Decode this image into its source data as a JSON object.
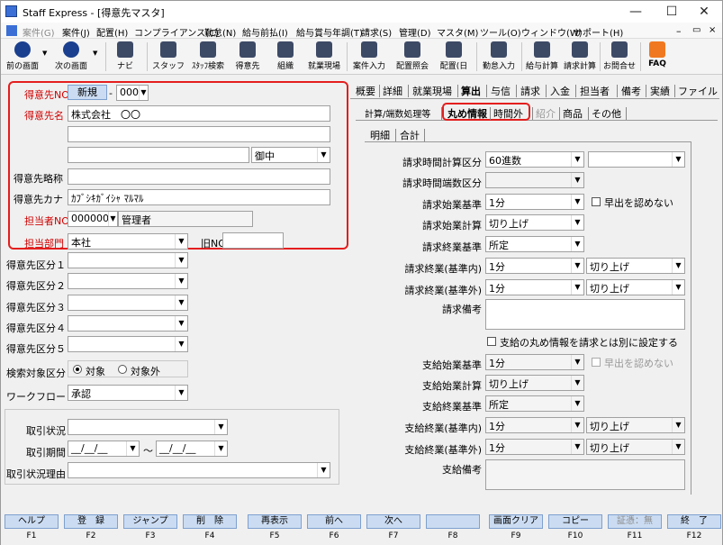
{
  "window": {
    "title": "Staff Express - [得意先マスタ]"
  },
  "menu": [
    {
      "label": "案件(G)",
      "disabled": true
    },
    {
      "label": "案件(J)",
      "disabled": false
    },
    {
      "label": "配置(H)",
      "disabled": false
    },
    {
      "label": "コンプライアンス(C)",
      "disabled": false
    },
    {
      "label": "勤怠(N)",
      "disabled": false
    },
    {
      "label": "給与前払(I)",
      "disabled": false
    },
    {
      "label": "給与賞与年調(T)",
      "disabled": false
    },
    {
      "label": "請求(S)",
      "disabled": false
    },
    {
      "label": "管理(D)",
      "disabled": false
    },
    {
      "label": "マスタ(M)",
      "disabled": false
    },
    {
      "label": "ツール(O)",
      "disabled": false
    },
    {
      "label": "ウィンドウ(W)",
      "disabled": false
    },
    {
      "label": "サポート(H)",
      "disabled": false
    }
  ],
  "toolbar": [
    "前の画面",
    "次の画面",
    "ナビ",
    "スタッフ",
    "ｽﾀｯﾌ検索",
    "得意先",
    "組織",
    "就業現場",
    "案件入力",
    "配置照会",
    "配置(日",
    "勤怠入力",
    "給与計算",
    "請求計算",
    "お問合せ",
    "FAQ"
  ],
  "form": {
    "tokuisaki_no_label": "得意先NO",
    "new_badge": "新規",
    "dash": "-",
    "branch_no": "000",
    "name_label": "得意先名",
    "name": "株式会社　〇〇",
    "name2": "",
    "name3": "",
    "name4": "",
    "honorific": "御中",
    "short_name_label": "得意先略称",
    "short_name": "",
    "kana_label": "得意先カナ",
    "kana": "ｶﾌﾞｼｷｶﾞｲｼｬ ﾏﾙﾏﾙ",
    "tanto_label": "担当者NO",
    "tanto_no": "000000",
    "tanto_name": "管理者",
    "dept_label": "担当部門",
    "dept": "本社",
    "old_no_label": "旧NO",
    "old_no": "",
    "cat1": "得意先区分１",
    "cat2": "得意先区分２",
    "cat3": "得意先区分３",
    "cat4": "得意先区分４",
    "cat5": "得意先区分５",
    "search_label": "検索対象区分",
    "search_opt1": "対象",
    "search_opt2": "対象外",
    "workflow_label": "ワークフロー",
    "workflow": "承認",
    "torihiki_status": "取引状況",
    "torihiki_period": "取引期間",
    "period_from": "__/__/__",
    "tilde": "〜",
    "period_to": "__/__/__",
    "torihiki_reason": "取引状況理由"
  },
  "tabs_main": [
    "概要",
    "詳細",
    "就業現場",
    "算出",
    "与信",
    "請求",
    "入金",
    "担当者",
    "備考",
    "実績",
    "ファイル"
  ],
  "tabs_sub": [
    "計算/端数処理等",
    "丸め情報",
    "時間外",
    "紹介",
    "商品",
    "その他"
  ],
  "tabs_detail": [
    "明細",
    "合計"
  ],
  "rounding": {
    "r1_label": "請求時間計算区分",
    "r1": "60進数",
    "r1b": "",
    "r2_label": "請求時間端数区分",
    "r2": "",
    "r3_label": "請求始業基準",
    "r3": "1分",
    "early_label": "早出を認めない",
    "r4_label": "請求始業計算",
    "r4": "切り上げ",
    "r5_label": "請求終業基準",
    "r5": "所定",
    "r6_label": "請求終業(基準内)",
    "r6": "1分",
    "r6b": "切り上げ",
    "r7_label": "請求終業(基準外)",
    "r7": "1分",
    "r7b": "切り上げ",
    "r8_label": "請求備考",
    "separate_label": "支給の丸め情報を請求とは別に設定する",
    "s1_label": "支給始業基準",
    "s1": "1分",
    "s_early_label": "早出を認めない",
    "s2_label": "支給始業計算",
    "s2": "切り上げ",
    "s3_label": "支給終業基準",
    "s3": "所定",
    "s4_label": "支給終業(基準内)",
    "s4": "1分",
    "s4b": "切り上げ",
    "s5_label": "支給終業(基準外)",
    "s5": "1分",
    "s5b": "切り上げ",
    "s6_label": "支給備考"
  },
  "fkeys": [
    {
      "label": "ヘルプ",
      "key": "F1"
    },
    {
      "label": "登　録",
      "key": "F2"
    },
    {
      "label": "ジャンプ",
      "key": "F3"
    },
    {
      "label": "削　除",
      "key": "F4"
    },
    {
      "label": "再表示",
      "key": "F5"
    },
    {
      "label": "前へ",
      "key": "F6"
    },
    {
      "label": "次へ",
      "key": "F7"
    },
    {
      "label": "",
      "key": "F8"
    },
    {
      "label": "画面クリア",
      "key": "F9"
    },
    {
      "label": "コピー",
      "key": "F10"
    },
    {
      "label": "証憑：無",
      "key": "F11"
    },
    {
      "label": "終　了",
      "key": "F12"
    }
  ]
}
